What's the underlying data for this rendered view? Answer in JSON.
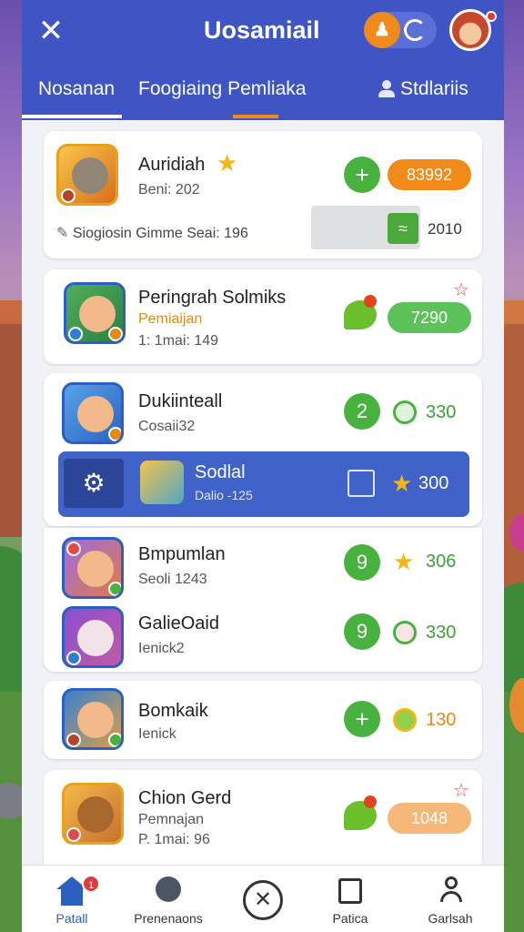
{
  "header": {
    "title": "Uosamiail",
    "tabs": [
      {
        "label": "Nosanan"
      },
      {
        "label": "Foogiaing Pemliaka"
      },
      {
        "label": "Stdlariis"
      }
    ]
  },
  "cards": [
    {
      "name": "Auridiah",
      "sub": "Beni: 202",
      "meta": "Siogiosin Gimme Seai: 196",
      "score": "83992",
      "extra_value": "2010"
    },
    {
      "name": "Peringrah Solmiks",
      "sub": "Pemiaijan",
      "meta": "1: 1mai: 149",
      "score": "7290"
    },
    {
      "name": "Dukiinteall",
      "sub": "Cosaii32",
      "round": "2",
      "score": "330"
    },
    {
      "name": "Sodlal",
      "sub": "Dalio -125",
      "score": "300"
    },
    {
      "name": "Bmpumlan",
      "sub": "Seoli 1243",
      "round": "9",
      "score": "306"
    },
    {
      "name": "GalieOaid",
      "sub": "Ienick2",
      "round": "9",
      "score": "330"
    },
    {
      "name": "Bomkaik",
      "sub": "Ienick",
      "round": "+",
      "score": "130"
    },
    {
      "name": "Chion Gerd",
      "sub": "Pemnajan",
      "meta": "P. 1mai: 96",
      "score": "1048"
    }
  ],
  "first_round": "+",
  "bottom_nav": [
    {
      "label": "Patall"
    },
    {
      "label": "Prenenaons"
    },
    {
      "label": ""
    },
    {
      "label": "Patica"
    },
    {
      "label": "Garlsah"
    }
  ],
  "colors": {
    "primary": "#3f55c3",
    "accent": "#f08a1c",
    "success": "#48b23f"
  }
}
